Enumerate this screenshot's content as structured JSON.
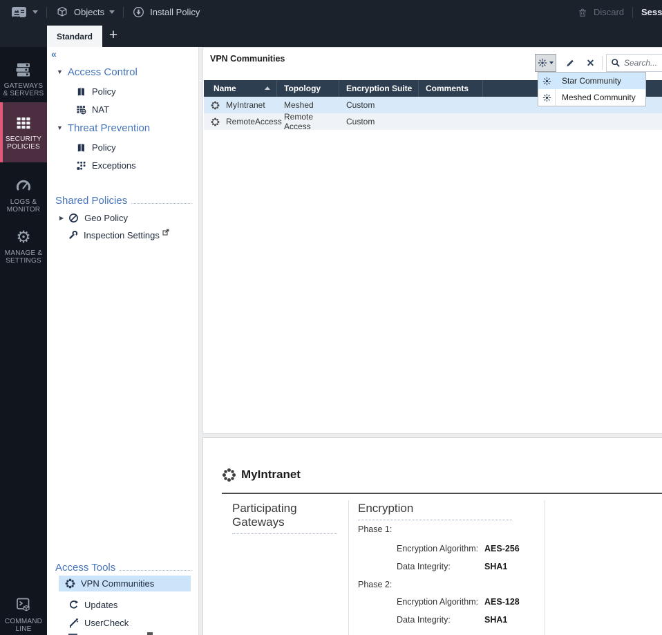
{
  "topbar": {
    "objects": "Objects",
    "install_policy": "Install Policy",
    "discard": "Discard",
    "session": "Sessi"
  },
  "tabs": {
    "active": "Standard",
    "add": "+"
  },
  "rail": {
    "items": [
      {
        "l1": "GATEWAYS",
        "l2": "& SERVERS"
      },
      {
        "l1": "SECURITY",
        "l2": "POLICIES"
      },
      {
        "l1": "LOGS &",
        "l2": "MONITOR"
      },
      {
        "l1": "MANAGE &",
        "l2": "SETTINGS"
      },
      {
        "l1": "COMMAND",
        "l2": "LINE"
      }
    ]
  },
  "sidebar": {
    "collapse": "«",
    "access_control": "Access Control",
    "ac_policy": "Policy",
    "nat": "NAT",
    "threat_prevention": "Threat Prevention",
    "tp_policy": "Policy",
    "exceptions": "Exceptions",
    "shared_policies": "Shared Policies",
    "geo_policy": "Geo Policy",
    "inspection_settings": "Inspection Settings",
    "access_tools": "Access Tools",
    "vpn_communities": "VPN Communities",
    "updates": "Updates",
    "usercheck": "UserCheck"
  },
  "main": {
    "title": "VPN Communities",
    "search_placeholder": "Search...",
    "columns": [
      "Name",
      "Topology",
      "Encryption Suite",
      "Comments"
    ],
    "rows": [
      {
        "name": "MyIntranet",
        "topology": "Meshed",
        "suite": "Custom",
        "comments": ""
      },
      {
        "name": "RemoteAccess",
        "topology": "Remote Access",
        "suite": "Custom",
        "comments": ""
      }
    ],
    "new_menu": [
      {
        "label": "Star Community"
      },
      {
        "label": "Meshed Community"
      }
    ]
  },
  "details": {
    "title": "MyIntranet",
    "section1": "Participating Gateways",
    "section2": "Encryption",
    "phase1": "Phase 1:",
    "phase2": "Phase 2:",
    "enc_alg_label": "Encryption Algorithm:",
    "data_int_label": "Data Integrity:",
    "p1_alg": "AES-256",
    "p1_int": "SHA1",
    "p2_alg": "AES-128",
    "p2_int": "SHA1"
  },
  "colors": {
    "selection_blue": "#cbe4f9",
    "rail_active_bg": "#4b2f40",
    "rail_active_stripe": "#e05a78",
    "table_header_navy": "#2d3e50",
    "link_blue": "#4574b9",
    "topbar_dark": "#1b222c"
  }
}
